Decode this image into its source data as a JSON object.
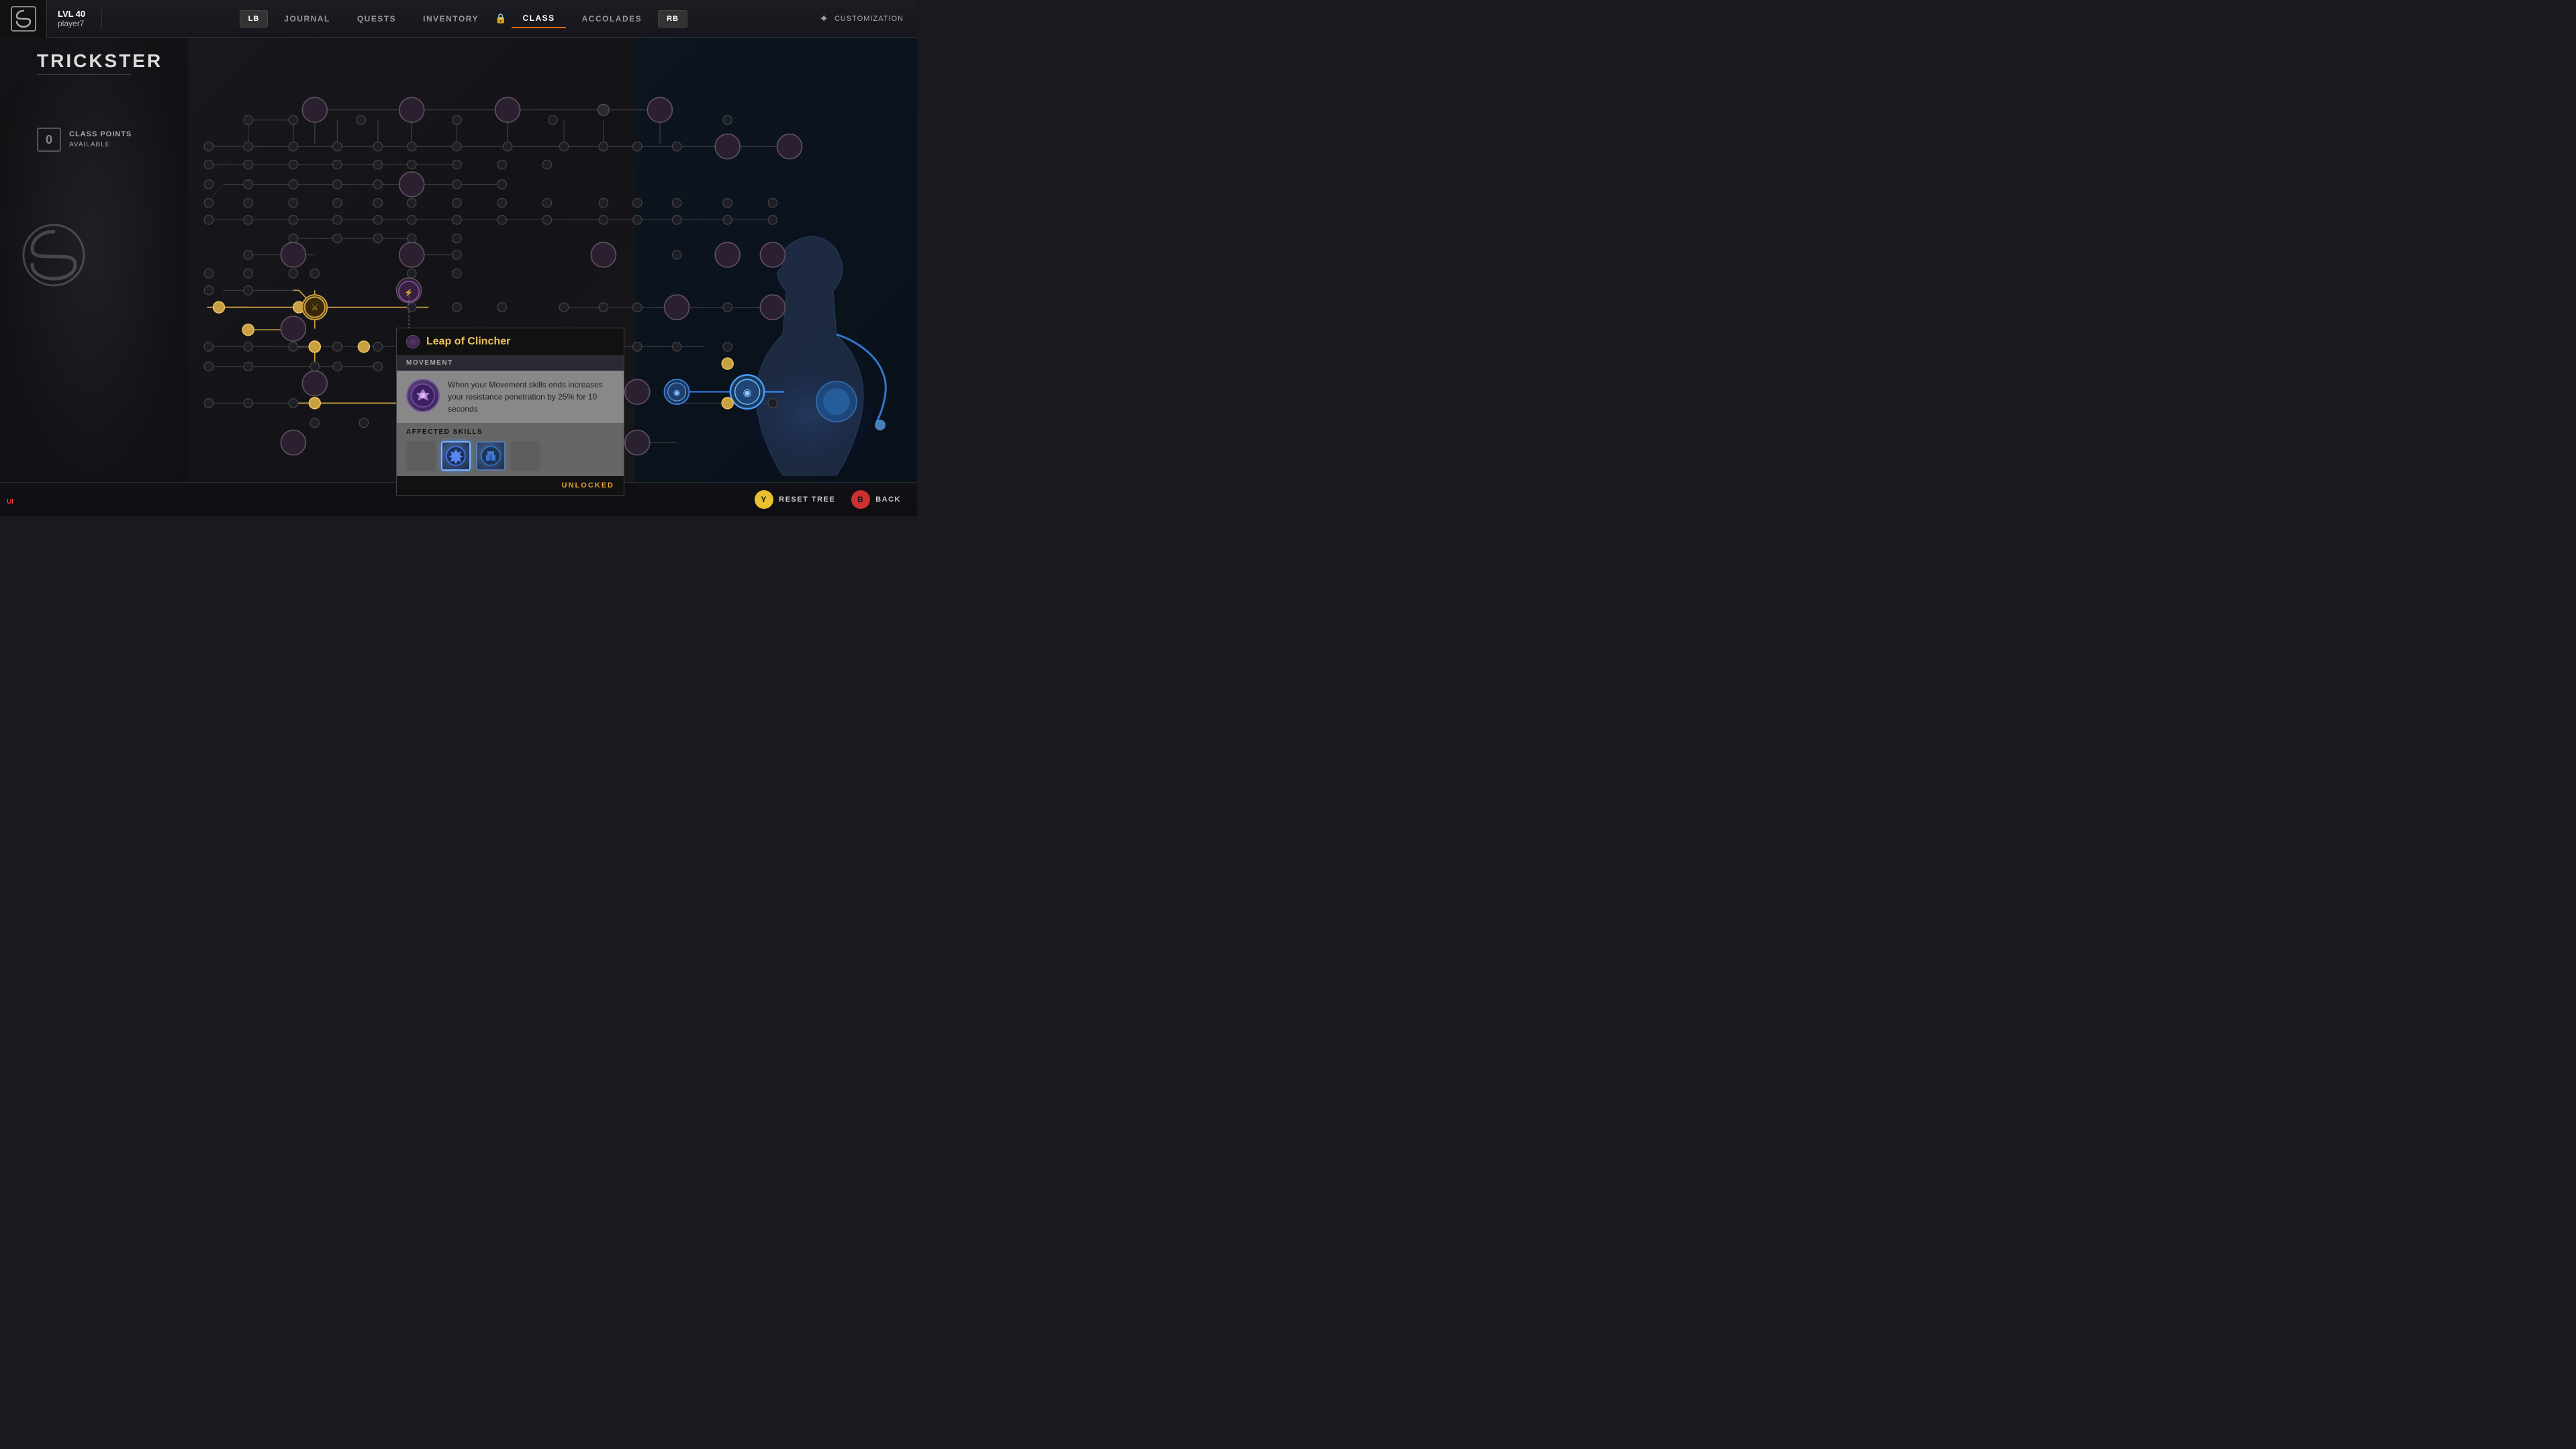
{
  "header": {
    "logo_text": "S",
    "player_level_label": "LVL",
    "player_level": "40",
    "player_name": "player7",
    "nav_left_btn": "LB",
    "nav_right_btn": "RB",
    "nav_items": [
      {
        "label": "JOURNAL",
        "active": false
      },
      {
        "label": "QUESTS",
        "active": false
      },
      {
        "label": "INVENTORY",
        "active": false
      },
      {
        "label": "CLASS",
        "active": true
      },
      {
        "label": "ACCOLADES",
        "active": false
      }
    ],
    "customization_label": "CUSTOMIZATION"
  },
  "class": {
    "title": "TRICKSTER",
    "points_badge": "0",
    "points_label_line1": "CLASS POINTS",
    "points_label_line2": "AVAILABLE"
  },
  "tooltip": {
    "title": "Leap of Clincher",
    "category": "MOVEMENT",
    "description": "When your Movement skills ends increases your resistance penetration by 25% for 10 seconds",
    "affected_label": "AFFECTED SKILLS",
    "status": "UNLOCKED"
  },
  "bottom_bar": {
    "reset_btn": "Y",
    "reset_label": "RESET TREE",
    "back_btn": "B",
    "back_label": "BACK"
  },
  "ui_debug": "UI"
}
